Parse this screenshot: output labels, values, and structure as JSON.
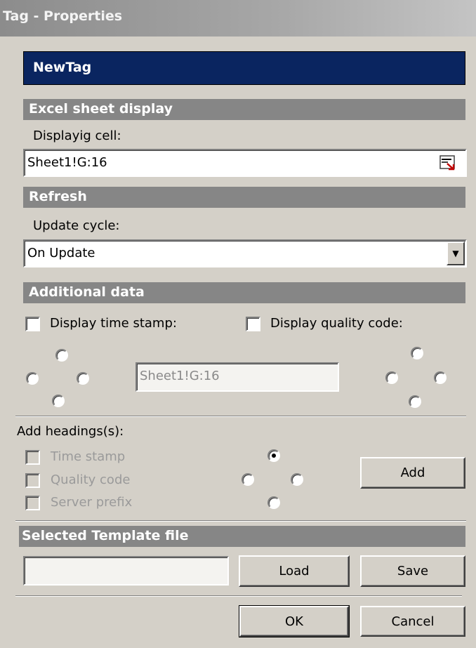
{
  "window": {
    "title": "Tag - Properties"
  },
  "tag": {
    "name": "NewTag"
  },
  "excel_display": {
    "section_title": "Excel sheet display",
    "cell_label": "Displayig cell:",
    "cell_value": "Sheet1!G:16"
  },
  "refresh": {
    "section_title": "Refresh",
    "cycle_label": "Update cycle:",
    "cycle_value": "On Update"
  },
  "additional": {
    "section_title": "Additional data",
    "timestamp_label": "Display time stamp:",
    "quality_label": "Display quality code:",
    "cell_value": "Sheet1!G:16"
  },
  "headings": {
    "label": "Add headings(s):",
    "timestamp": "Time stamp",
    "quality": "Quality code",
    "server": "Server prefix",
    "add_button": "Add"
  },
  "template": {
    "section_title": "Selected Template file",
    "file_value": "",
    "load_button": "Load",
    "save_button": "Save"
  },
  "footer": {
    "ok": "OK",
    "cancel": "Cancel"
  }
}
